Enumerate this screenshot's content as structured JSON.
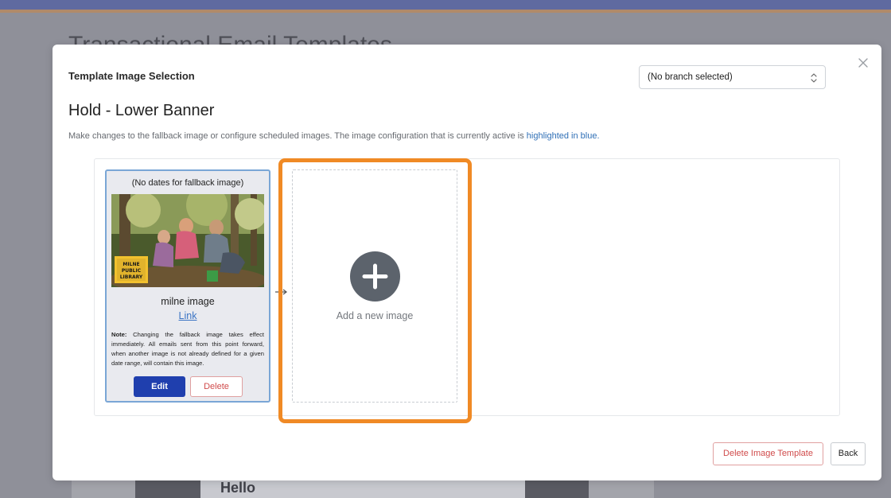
{
  "background": {
    "page_title": "Transactional Email Templates",
    "preview_heading": "Hello"
  },
  "modal": {
    "heading": "Template Image Selection",
    "branch_select": {
      "value": "(No branch selected)"
    },
    "template_name": "Hold - Lower Banner",
    "description": {
      "text": "Make changes to the fallback image or configure scheduled images. The image configuration that is currently active is ",
      "highlight": "highlighted in blue."
    },
    "fallback_card": {
      "dates": "(No dates for fallback image)",
      "image_logo_lines": [
        "MILNE",
        "PUBLIC",
        "LIBRARY"
      ],
      "name": "milne image",
      "link_label": "Link",
      "note_label": "Note:",
      "note_text": " Changing the fallback image takes effect immediately. All emails sent from this point forward, when another image is not already defined for a given date range, will contain this image.",
      "edit_label": "Edit",
      "delete_label": "Delete"
    },
    "add_tile": {
      "label": "Add a new image"
    },
    "footer": {
      "delete_template_label": "Delete Image Template",
      "back_label": "Back"
    }
  },
  "colors": {
    "primary": "#1f3fae",
    "danger": "#d04b4b",
    "highlight": "#f08a25",
    "active_border": "#7aa6d6",
    "link": "#3b74c4"
  },
  "icons": [
    "close-icon",
    "chevron-updown-icon",
    "plus-icon",
    "arrow-right-icon"
  ]
}
